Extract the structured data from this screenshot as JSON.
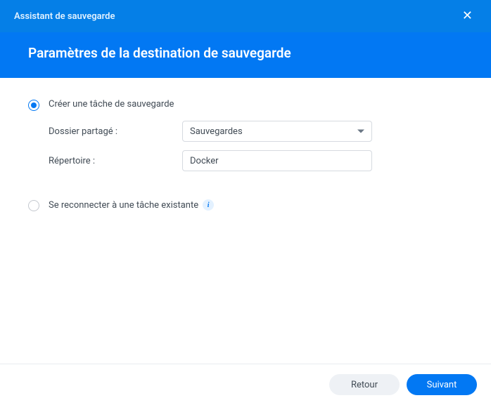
{
  "header": {
    "wizard_title": "Assistant de sauvegarde",
    "page_title": "Paramètres de la destination de sauvegarde"
  },
  "options": {
    "create": {
      "label": "Créer une tâche de sauvegarde",
      "shared_folder_label": "Dossier partagé :",
      "shared_folder_value": "Sauvegardes",
      "directory_label": "Répertoire :",
      "directory_value": "Docker"
    },
    "reconnect": {
      "label": "Se reconnecter à une tâche existante"
    }
  },
  "footer": {
    "back": "Retour",
    "next": "Suivant"
  }
}
